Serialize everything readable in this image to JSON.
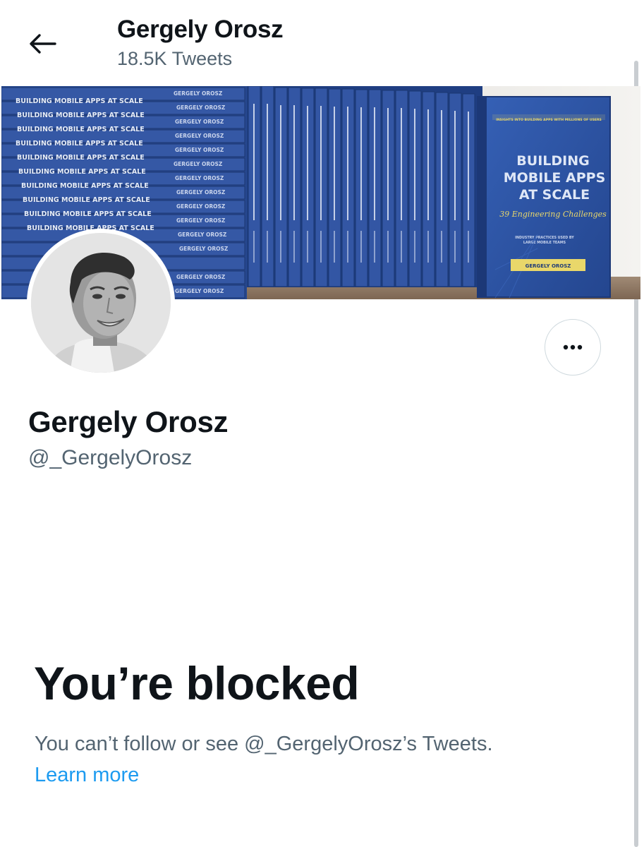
{
  "header": {
    "back_icon": "arrow-left-icon",
    "title": "Gergely Orosz",
    "tweet_count": "18.5K Tweets"
  },
  "banner": {
    "stack_spine_text": "BUILDING MOBILE APPS AT SCALE",
    "stack_author_text": "GERGELY OROSZ",
    "cover": {
      "kicker": "INSIGHTS INTO BUILDING APPS WITH MILLIONS OF USERS",
      "title_line1": "BUILDING",
      "title_line2": "MOBILE APPS",
      "title_line3": "AT SCALE",
      "subtitle": "39 Engineering Challenges",
      "tagline_line1": "INDUSTRY PRACTICES USED BY",
      "tagline_line2": "LARGE MOBILE TEAMS",
      "author": "GERGELY OROSZ"
    },
    "colors": {
      "book_blue": "#2f55a8",
      "cover_yellow": "#e9d76a"
    }
  },
  "profile": {
    "name": "Gergely Orosz",
    "handle": "@_GergelyOrosz",
    "more_icon": "more-horizontal-icon"
  },
  "blocked": {
    "title": "You’re blocked",
    "message": "You can’t follow or see @_GergelyOrosz’s Tweets.",
    "learn_more": "Learn more"
  },
  "colors": {
    "text_primary": "#0f1419",
    "text_secondary": "#536471",
    "link": "#1d9bf0",
    "border": "#cfd9de"
  }
}
